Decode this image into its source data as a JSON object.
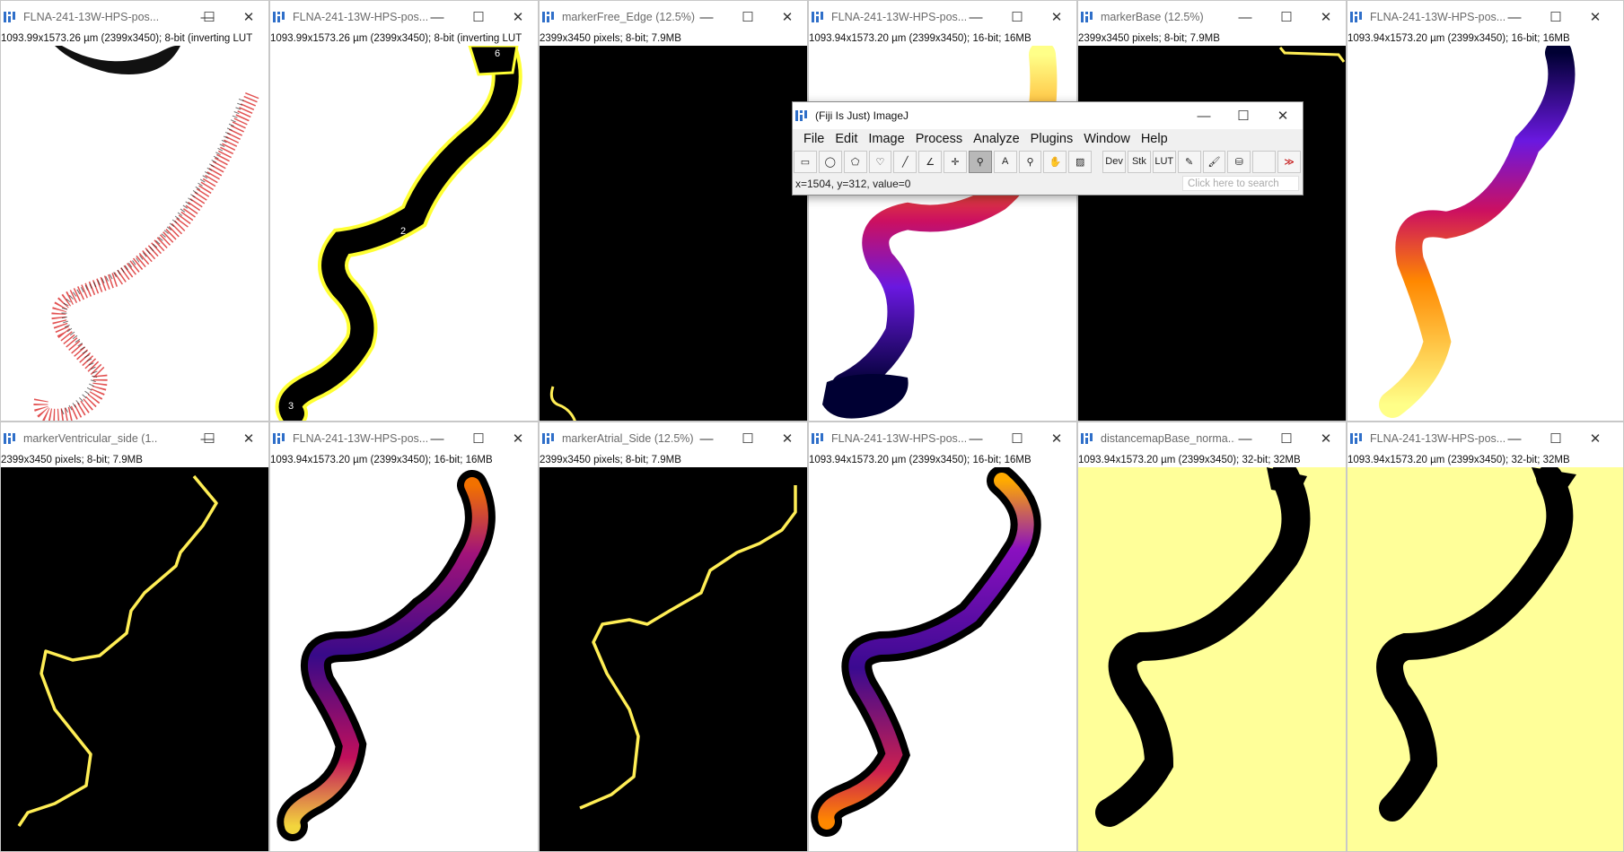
{
  "windows": [
    {
      "title": "FLNA-241-13W-HPS-pos...",
      "info": "1093.99x1573.26 µm (2399x3450); 8-bit (inverting LUT"
    },
    {
      "title": "FLNA-241-13W-HPS-pos...",
      "info": "1093.99x1573.26 µm (2399x3450); 8-bit (inverting LUT"
    },
    {
      "title": "markerFree_Edge (12.5%)",
      "info": "2399x3450 pixels; 8-bit; 7.9MB"
    },
    {
      "title": "FLNA-241-13W-HPS-pos...",
      "info": "1093.94x1573.20 µm (2399x3450); 16-bit; 16MB"
    },
    {
      "title": "markerBase (12.5%)",
      "info": "2399x3450 pixels; 8-bit; 7.9MB"
    },
    {
      "title": "FLNA-241-13W-HPS-pos...",
      "info": "1093.94x1573.20 µm (2399x3450); 16-bit; 16MB"
    },
    {
      "title": "markerVentricular_side (1...",
      "info": "2399x3450 pixels; 8-bit; 7.9MB"
    },
    {
      "title": "FLNA-241-13W-HPS-pos...",
      "info": "1093.94x1573.20 µm (2399x3450); 16-bit; 16MB"
    },
    {
      "title": "markerAtrial_Side (12.5%)",
      "info": "2399x3450 pixels; 8-bit; 7.9MB"
    },
    {
      "title": "FLNA-241-13W-HPS-pos...",
      "info": "1093.94x1573.20 µm (2399x3450); 16-bit; 16MB"
    },
    {
      "title": "distancemapBase_norma...",
      "info": "1093.94x1573.20 µm (2399x3450); 32-bit; 32MB"
    },
    {
      "title": "FLNA-241-13W-HPS-pos...",
      "info": "1093.94x1573.20 µm (2399x3450); 32-bit; 32MB"
    }
  ],
  "window_controls": {
    "minimize": "—",
    "maximize": "☐",
    "close": "✕"
  },
  "roi_labels": [
    "6",
    "2",
    "3"
  ],
  "imagej": {
    "title": "(Fiji Is Just) ImageJ",
    "menus": [
      "File",
      "Edit",
      "Image",
      "Process",
      "Analyze",
      "Plugins",
      "Window",
      "Help"
    ],
    "tools": [
      {
        "name": "rectangle-tool",
        "glyph": "▭"
      },
      {
        "name": "oval-tool",
        "glyph": "◯"
      },
      {
        "name": "polygon-tool",
        "glyph": "⬠"
      },
      {
        "name": "freehand-tool",
        "glyph": "♡"
      },
      {
        "name": "line-tool",
        "glyph": "╱"
      },
      {
        "name": "angle-tool",
        "glyph": "∠"
      },
      {
        "name": "point-tool",
        "glyph": "✛"
      },
      {
        "name": "wand-tool",
        "glyph": "⚲"
      },
      {
        "name": "text-tool",
        "glyph": "A"
      },
      {
        "name": "zoom-tool",
        "glyph": "⚲"
      },
      {
        "name": "hand-tool",
        "glyph": "✋"
      },
      {
        "name": "color-picker-tool",
        "glyph": "▨"
      },
      {
        "name": "dev-tool",
        "glyph": "Dev"
      },
      {
        "name": "stk-tool",
        "glyph": "Stk"
      },
      {
        "name": "lut-tool",
        "glyph": "LUT"
      },
      {
        "name": "pencil-tool",
        "glyph": "✎"
      },
      {
        "name": "brush-tool",
        "glyph": "🖌"
      },
      {
        "name": "flood-fill-tool",
        "glyph": "⛁"
      },
      {
        "name": "blank-tool",
        "glyph": ""
      },
      {
        "name": "more-tools",
        "glyph": "≫"
      }
    ],
    "status": "x=1504, y=312, value=0",
    "search_placeholder": "Click here to search"
  }
}
